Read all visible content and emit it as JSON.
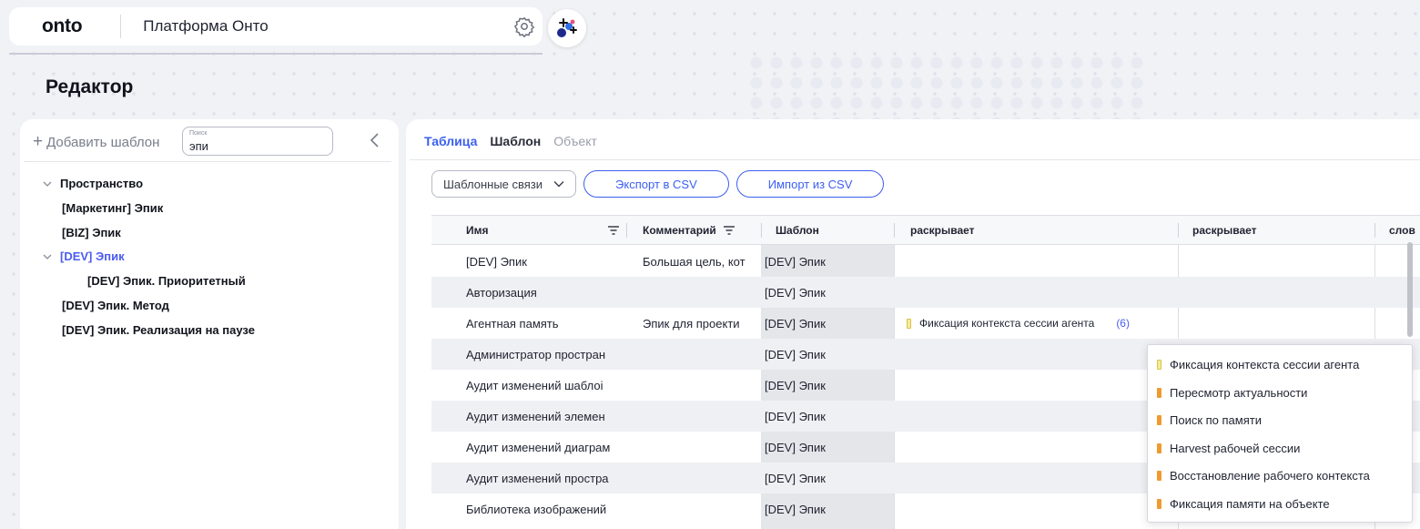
{
  "header": {
    "logo": "onto",
    "platform_title": "Платформа Онто"
  },
  "page": {
    "title": "Редактор"
  },
  "left_panel": {
    "add_template_label": "Добавить шаблон",
    "search": {
      "label": "Поиск",
      "value": "эпи"
    },
    "tree": [
      {
        "label": "Пространство",
        "level": 0,
        "expanded": true,
        "active": false
      },
      {
        "label": "[Маркетинг] Эпик",
        "level": 1,
        "active": false
      },
      {
        "label": "[BIZ] Эпик",
        "level": 1,
        "active": false
      },
      {
        "label": "[DEV] Эпик",
        "level": 1,
        "expanded": true,
        "active": true
      },
      {
        "label": "[DEV] Эпик. Приоритетный",
        "level": 2,
        "active": false
      },
      {
        "label": "[DEV] Эпик. Метод",
        "level": 1,
        "active": false
      },
      {
        "label": "[DEV] Эпик. Реализация на паузе",
        "level": 1,
        "active": false
      }
    ]
  },
  "tabs": [
    {
      "label": "Таблица",
      "state": "active"
    },
    {
      "label": "Шаблон",
      "state": "normal"
    },
    {
      "label": "Объект",
      "state": "dim"
    }
  ],
  "toolbar": {
    "select_value": "Шаблонные связи",
    "export_label": "Экспорт в CSV",
    "import_label": "Импорт из CSV"
  },
  "table": {
    "columns": [
      "Имя",
      "Комментарий",
      "Шаблон",
      "раскрывает",
      "раскрывает",
      "слов"
    ],
    "rows": [
      {
        "name": "[DEV] Эпик",
        "comment": "Большая цель, кот",
        "template": "[DEV] Эпик",
        "ext": "",
        "count": ""
      },
      {
        "name": "Авторизация",
        "comment": "",
        "template": "[DEV] Эпик",
        "ext": "",
        "count": ""
      },
      {
        "name": "Агентная память",
        "comment": "Эпик для проекти",
        "template": "[DEV] Эпик",
        "ext": "Фиксация контекста сессии агента",
        "count": "(6)"
      },
      {
        "name": "Администратор простран",
        "comment": "",
        "template": "[DEV] Эпик",
        "ext": "",
        "count": ""
      },
      {
        "name": "Аудит изменений  шаблоі",
        "comment": "",
        "template": "[DEV] Эпик",
        "ext": "",
        "count": ""
      },
      {
        "name": "Аудит изменений  элемен",
        "comment": "",
        "template": "[DEV] Эпик",
        "ext": "",
        "count": ""
      },
      {
        "name": "Аудит изменений диаграм",
        "comment": "",
        "template": "[DEV] Эпик",
        "ext": "",
        "count": ""
      },
      {
        "name": "Аудит изменений простра",
        "comment": "",
        "template": "[DEV] Эпик",
        "ext": "",
        "count": ""
      },
      {
        "name": "Библиотека изображений",
        "comment": "",
        "template": "[DEV] Эпик",
        "ext": "",
        "count": ""
      }
    ]
  },
  "popover": {
    "items": [
      {
        "label": "Фиксация контекста сессии агента",
        "marker": "yellow"
      },
      {
        "label": "Пересмотр актуальности",
        "marker": "orange"
      },
      {
        "label": "Поиск по памяти",
        "marker": "orange"
      },
      {
        "label": "Harvest рабочей сессии",
        "marker": "orange"
      },
      {
        "label": "Восстановление рабочего контекста",
        "marker": "orange"
      },
      {
        "label": "Фиксация памяти на объекте",
        "marker": "orange"
      }
    ]
  },
  "colors": {
    "accent": "#3c5ff0",
    "active_tree": "#4b5cf0",
    "marker_yellow": "#f6ec9a",
    "marker_orange": "#ef9a2e"
  }
}
